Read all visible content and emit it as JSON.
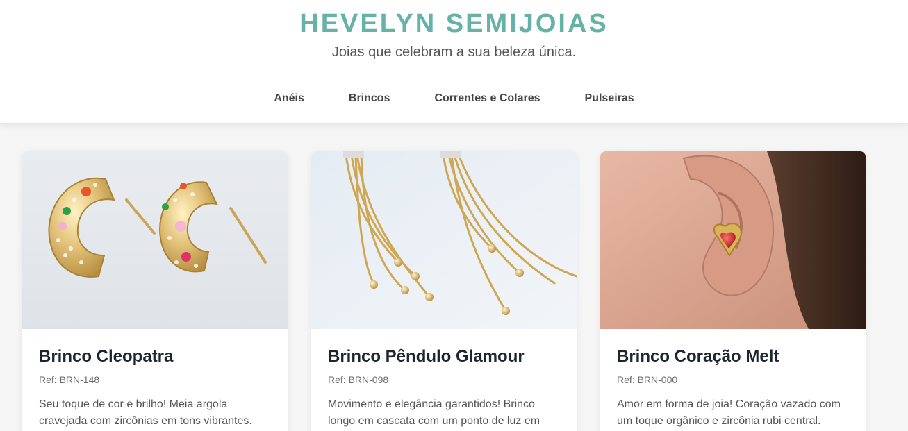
{
  "header": {
    "brand": "HEVELYN SEMIJOIAS",
    "tagline": "Joias que celebram a sua beleza única."
  },
  "nav": {
    "items": [
      {
        "label": "Anéis"
      },
      {
        "label": "Brincos"
      },
      {
        "label": "Correntes e Colares"
      },
      {
        "label": "Pulseiras"
      }
    ]
  },
  "products": [
    {
      "title": "Brinco Cleopatra",
      "ref": "Ref: BRN-148",
      "description": "Seu toque de cor e brilho! Meia argola cravejada com zircônias em tons vibrantes.",
      "image": "gold-hoop-earrings-colored-stones"
    },
    {
      "title": "Brinco Pêndulo Glamour",
      "ref": "Ref: BRN-098",
      "description": "Movimento e elegância garantidos! Brinco longo em cascata com um ponto de luz em",
      "image": "gold-cascade-drop-earrings"
    },
    {
      "title": "Brinco Coração Melt",
      "ref": "Ref: BRN-000",
      "description": "Amor em forma de joia! Coração vazado com um toque orgânico e zircônia rubi central.",
      "image": "heart-stud-earring-on-ear"
    }
  ],
  "colors": {
    "brand": "#66b2a6",
    "background": "#f5f5f5",
    "title": "#1d2630"
  }
}
